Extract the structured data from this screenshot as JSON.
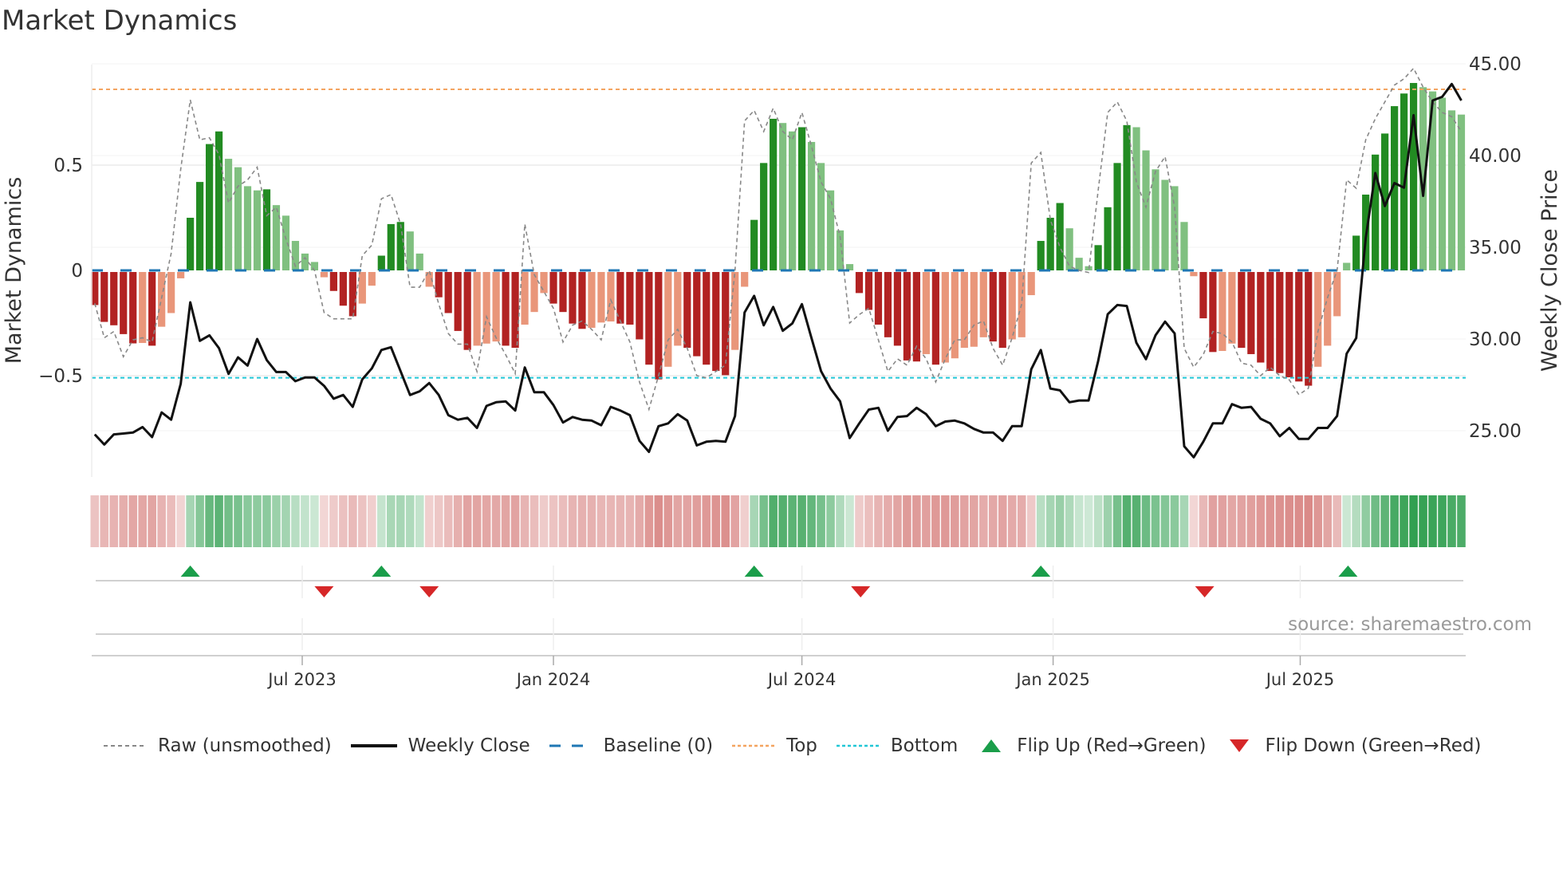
{
  "title": "Market Dynamics",
  "source": "source: sharemaestro.com",
  "legend": [
    {
      "label": "Raw (unsmoothed)",
      "icon": "dashed-gray-line"
    },
    {
      "label": "Weekly Close",
      "icon": "solid-black-line"
    },
    {
      "label": "Baseline (0)",
      "icon": "dashed-blue-line"
    },
    {
      "label": "Top",
      "icon": "dotted-orange-line"
    },
    {
      "label": "Bottom",
      "icon": "dotted-cyan-line"
    },
    {
      "label": "Flip Up (Red→Green)",
      "icon": "triangle-up-icon"
    },
    {
      "label": "Flip Down (Green→Red)",
      "icon": "triangle-down-icon"
    }
  ],
  "colors": {
    "dark_green": "#228b22",
    "light_green": "#80c080",
    "dark_red": "#b22222",
    "light_red": "#e9967a",
    "close": "#111111",
    "raw": "#888888",
    "baseline": "#1f77b4",
    "top": "#f4a460",
    "bottom": "#22c7d6",
    "flip_up": "#1a9e4a",
    "flip_down": "#d62728",
    "strip_green": "#2e9e4e",
    "strip_red": "#c8524f"
  },
  "chart_data": {
    "type": "bar",
    "title": "Market Dynamics",
    "ylabel": "Market Dynamics",
    "y2label": "Weekly Close Price",
    "ylim": [
      -0.97,
      1.0
    ],
    "y2lim": [
      22.5,
      45.5
    ],
    "yticks": [
      "0.5",
      "0",
      "−0.5"
    ],
    "yticks_values": [
      0.5,
      0,
      -0.5
    ],
    "y2ticks": [
      "45.00",
      "40.00",
      "35.00",
      "30.00",
      "25.00"
    ],
    "y2ticks_values": [
      45,
      40,
      35,
      30,
      25
    ],
    "xticks": [
      {
        "label": "Jul 2023",
        "date": "2023-07-01"
      },
      {
        "label": "Jan 2024",
        "date": "2024-01-01"
      },
      {
        "label": "Jul 2024",
        "date": "2024-07-01"
      },
      {
        "label": "Jan 2025",
        "date": "2025-01-01"
      },
      {
        "label": "Jul 2025",
        "date": "2025-07-01"
      }
    ],
    "start_date": "2023-01-30",
    "interval_days": 7,
    "top_level": 0.86,
    "bottom_level": -0.51,
    "baseline": 0,
    "dynamics": [
      -0.157,
      -0.237,
      -0.253,
      -0.295,
      -0.339,
      -0.337,
      -0.35,
      -0.26,
      -0.195,
      -0.03,
      0.25,
      0.42,
      0.6,
      0.66,
      0.53,
      0.49,
      0.4,
      0.38,
      0.385,
      0.31,
      0.26,
      0.14,
      0.08,
      0.04,
      -0.025,
      -0.09,
      -0.16,
      -0.21,
      -0.15,
      -0.065,
      0.07,
      0.22,
      0.23,
      0.185,
      0.08,
      -0.07,
      -0.12,
      -0.195,
      -0.28,
      -0.37,
      -0.35,
      -0.34,
      -0.33,
      -0.35,
      -0.36,
      -0.25,
      -0.19,
      -0.1,
      -0.15,
      -0.19,
      -0.245,
      -0.27,
      -0.265,
      -0.24,
      -0.235,
      -0.245,
      -0.25,
      -0.32,
      -0.44,
      -0.51,
      -0.45,
      -0.35,
      -0.36,
      -0.4,
      -0.44,
      -0.47,
      -0.49,
      -0.37,
      -0.07,
      0.24,
      0.51,
      0.72,
      0.7,
      0.66,
      0.68,
      0.61,
      0.51,
      0.38,
      0.19,
      0.03,
      -0.1,
      -0.18,
      -0.25,
      -0.31,
      -0.35,
      -0.42,
      -0.425,
      -0.39,
      -0.44,
      -0.43,
      -0.41,
      -0.36,
      -0.355,
      -0.31,
      -0.33,
      -0.36,
      -0.32,
      -0.31,
      -0.11,
      0.14,
      0.25,
      0.32,
      0.2,
      0.06,
      0.02,
      0.12,
      0.3,
      0.51,
      0.69,
      0.68,
      0.57,
      0.48,
      0.43,
      0.4,
      0.23,
      -0.02,
      -0.22,
      -0.38,
      -0.375,
      -0.34,
      -0.36,
      -0.39,
      -0.43,
      -0.47,
      -0.48,
      -0.5,
      -0.52,
      -0.54,
      -0.45,
      -0.35,
      -0.21,
      0.036,
      0.165,
      0.36,
      0.55,
      0.65,
      0.78,
      0.84,
      0.89,
      0.87,
      0.85,
      0.82,
      0.76,
      0.74
    ],
    "raw": [
      -0.157,
      -0.32,
      -0.29,
      -0.41,
      -0.33,
      -0.32,
      -0.34,
      -0.13,
      0.08,
      0.48,
      0.81,
      0.62,
      0.63,
      0.55,
      0.32,
      0.4,
      0.43,
      0.49,
      0.26,
      0.3,
      0.15,
      0.02,
      0.06,
      0.0,
      -0.2,
      -0.23,
      -0.23,
      -0.23,
      0.07,
      0.12,
      0.34,
      0.36,
      0.22,
      -0.08,
      -0.08,
      0.0,
      -0.16,
      -0.3,
      -0.35,
      -0.35,
      -0.48,
      -0.22,
      -0.32,
      -0.4,
      -0.49,
      0.22,
      -0.02,
      -0.1,
      -0.18,
      -0.34,
      -0.26,
      -0.24,
      -0.28,
      -0.33,
      -0.14,
      -0.24,
      -0.34,
      -0.53,
      -0.66,
      -0.5,
      -0.33,
      -0.28,
      -0.37,
      -0.5,
      -0.51,
      -0.48,
      -0.45,
      0.0,
      0.71,
      0.76,
      0.66,
      0.77,
      0.66,
      0.62,
      0.75,
      0.59,
      0.42,
      0.34,
      0.16,
      -0.25,
      -0.21,
      -0.18,
      -0.33,
      -0.48,
      -0.42,
      -0.45,
      -0.36,
      -0.42,
      -0.53,
      -0.42,
      -0.33,
      -0.33,
      -0.26,
      -0.24,
      -0.37,
      -0.45,
      -0.32,
      -0.16,
      0.51,
      0.56,
      0.24,
      0.11,
      0.02,
      0.0,
      -0.01,
      0.38,
      0.75,
      0.8,
      0.71,
      0.42,
      0.3,
      0.47,
      0.54,
      0.3,
      -0.37,
      -0.46,
      -0.4,
      -0.29,
      -0.3,
      -0.34,
      -0.44,
      -0.45,
      -0.5,
      -0.46,
      -0.5,
      -0.52,
      -0.59,
      -0.56,
      -0.29,
      -0.13,
      0.0,
      0.43,
      0.39,
      0.62,
      0.72,
      0.8,
      0.88,
      0.91,
      0.96,
      0.87,
      0.8,
      0.75,
      0.73,
      0.66
    ],
    "weekly_close": [
      24.8,
      24.25,
      24.8,
      24.85,
      24.9,
      25.2,
      24.65,
      26.0,
      25.6,
      27.55,
      32.0,
      29.9,
      30.2,
      29.5,
      28.1,
      29.0,
      28.55,
      30.0,
      28.85,
      28.2,
      28.2,
      27.7,
      27.9,
      27.9,
      27.45,
      26.75,
      26.95,
      26.3,
      27.8,
      28.4,
      29.4,
      29.55,
      28.25,
      26.95,
      27.15,
      27.6,
      26.95,
      25.85,
      25.6,
      25.7,
      25.15,
      26.35,
      26.55,
      26.6,
      26.1,
      28.45,
      27.1,
      27.1,
      26.4,
      25.45,
      25.75,
      25.6,
      25.55,
      25.3,
      26.3,
      26.1,
      25.85,
      24.45,
      23.85,
      25.25,
      25.4,
      25.9,
      25.55,
      24.2,
      24.4,
      24.45,
      24.4,
      25.8,
      31.45,
      32.35,
      30.75,
      31.75,
      30.45,
      30.85,
      31.9,
      30.05,
      28.25,
      27.3,
      26.6,
      24.6,
      25.4,
      26.15,
      26.25,
      25.0,
      25.75,
      25.8,
      26.25,
      25.9,
      25.25,
      25.5,
      25.55,
      25.4,
      25.1,
      24.9,
      24.9,
      24.45,
      25.25,
      25.25,
      28.35,
      29.4,
      27.3,
      27.2,
      26.55,
      26.65,
      26.65,
      28.8,
      31.35,
      31.85,
      31.8,
      29.8,
      28.9,
      30.2,
      30.95,
      30.3,
      24.15,
      23.55,
      24.4,
      25.4,
      25.4,
      26.45,
      26.25,
      26.3,
      25.65,
      25.4,
      24.7,
      25.15,
      24.55,
      24.55,
      25.15,
      25.15,
      25.8,
      29.2,
      30.05,
      35.5,
      39.05,
      37.25,
      38.5,
      38.25,
      42.2,
      37.8,
      43.0,
      43.2,
      43.9,
      43.0
    ],
    "flips": [
      {
        "type": "up",
        "date": "2023-04-10"
      },
      {
        "type": "down",
        "date": "2023-07-17"
      },
      {
        "type": "up",
        "date": "2023-08-28"
      },
      {
        "type": "down",
        "date": "2023-10-02"
      },
      {
        "type": "up",
        "date": "2024-05-27"
      },
      {
        "type": "down",
        "date": "2024-08-13"
      },
      {
        "type": "up",
        "date": "2024-12-23"
      },
      {
        "type": "down",
        "date": "2025-04-22"
      },
      {
        "type": "up",
        "date": "2025-08-05"
      }
    ]
  }
}
